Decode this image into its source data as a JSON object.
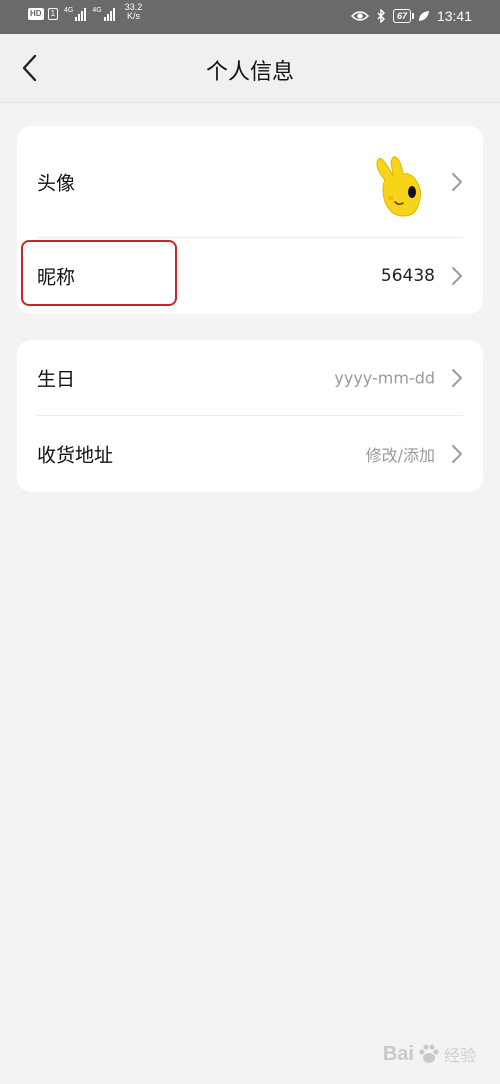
{
  "status_bar": {
    "hd_badge": "HD",
    "sim_badge": "1",
    "network_tag_1": "4G",
    "network_tag_2": "4G",
    "net_speed_value": "33.2",
    "net_speed_unit": "K/s",
    "battery_level": "67",
    "time": "13:41"
  },
  "nav": {
    "title": "个人信息"
  },
  "profile_card": {
    "avatar_label": "头像",
    "nickname_label": "昵称",
    "nickname_value": "56438"
  },
  "details_card": {
    "birthday_label": "生日",
    "birthday_placeholder": "yyyy-mm-dd",
    "address_label": "收货地址",
    "address_action": "修改/添加"
  },
  "watermark": {
    "brand": "Bai",
    "brand_tail": "经验"
  },
  "colors": {
    "status_bar_bg": "#6a6a6a",
    "page_bg": "#f3f3f3",
    "card_bg": "#ffffff",
    "highlight_border": "#c8262b",
    "muted_text": "#9a9a9a"
  }
}
